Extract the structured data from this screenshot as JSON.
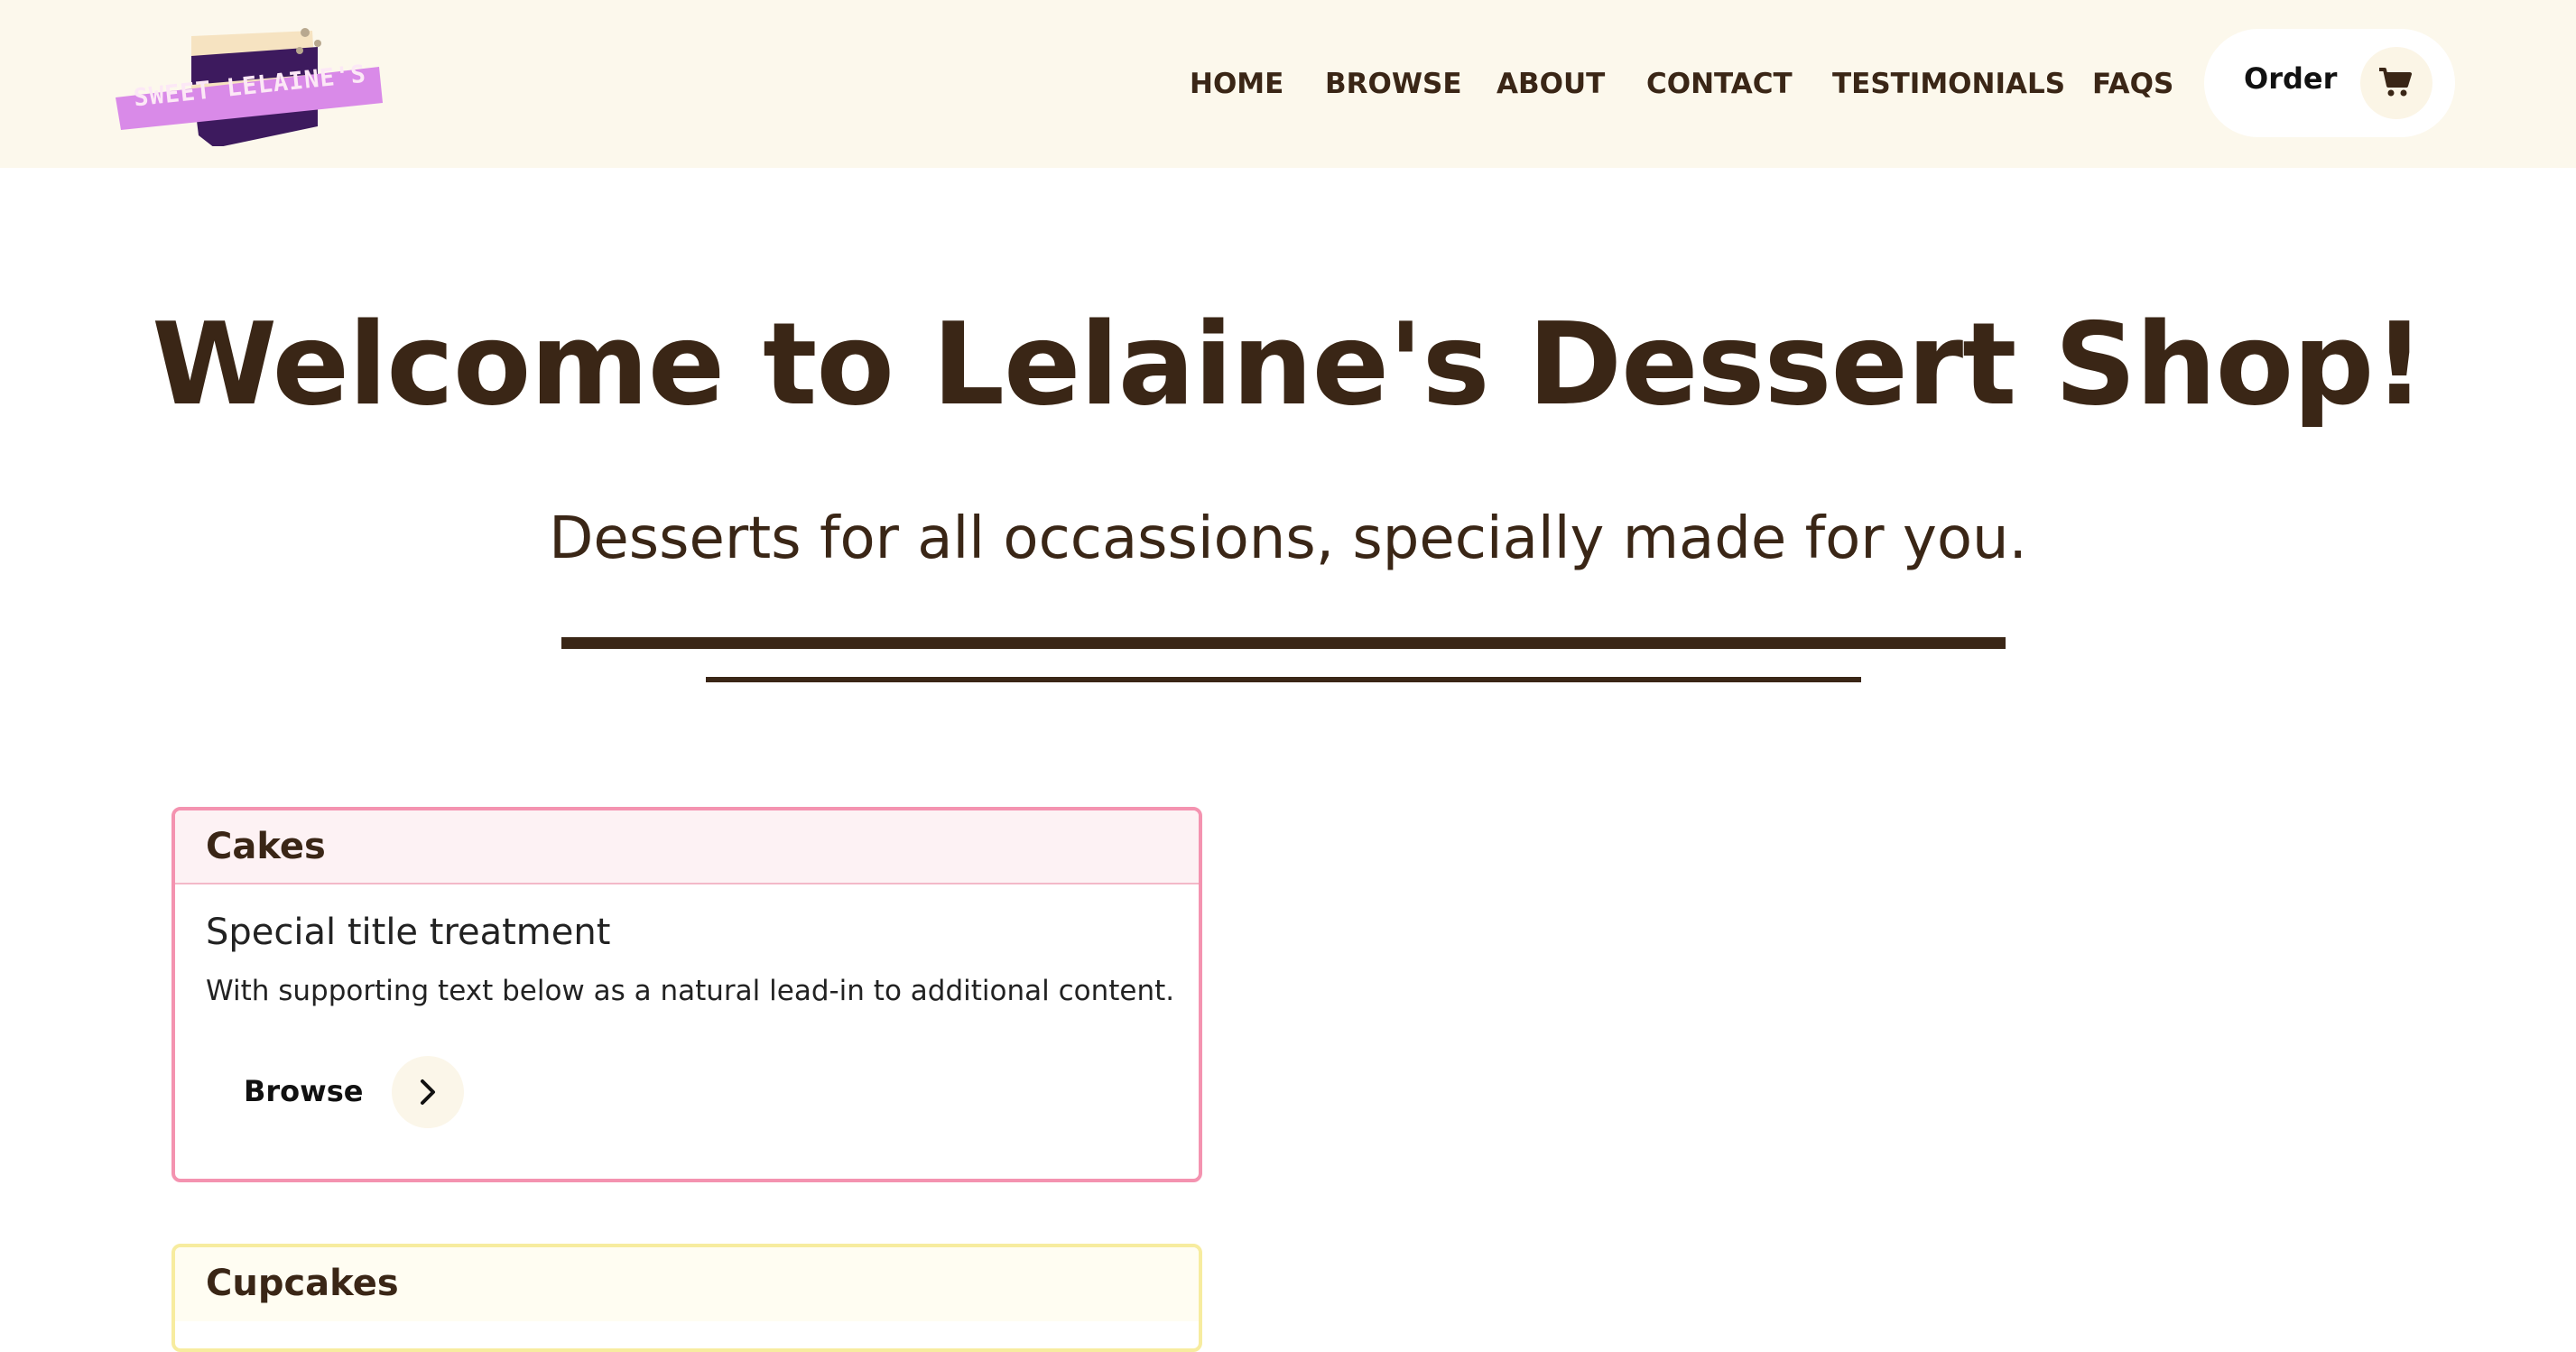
{
  "brand": {
    "logo_text": "SWEET LELAINE'S"
  },
  "nav": {
    "links": [
      "HOME",
      "BROWSE",
      "ABOUT",
      "CONTACT",
      "TESTIMONIALS",
      "FAQS"
    ],
    "order_label": "Order",
    "cart_icon": "shopping-cart-icon"
  },
  "hero": {
    "title": "Welcome to Lelaine's Dessert Shop!",
    "subtitle": "Desserts for all occassions, specially made for you."
  },
  "categories": [
    {
      "header": "Cakes",
      "title": "Special title treatment",
      "text": "With supporting text below as a natural lead-in to additional content.",
      "button_label": "Browse",
      "button_icon": "chevron-right-icon",
      "border_color": "#f493b0"
    },
    {
      "header": "Cupcakes",
      "border_color": "#f7ec9f"
    }
  ],
  "colors": {
    "navbar_bg": "#fcf8ec",
    "text_brown": "#3a2616",
    "logo_purple": "#3d1a5e",
    "logo_label": "#d98ae8"
  }
}
